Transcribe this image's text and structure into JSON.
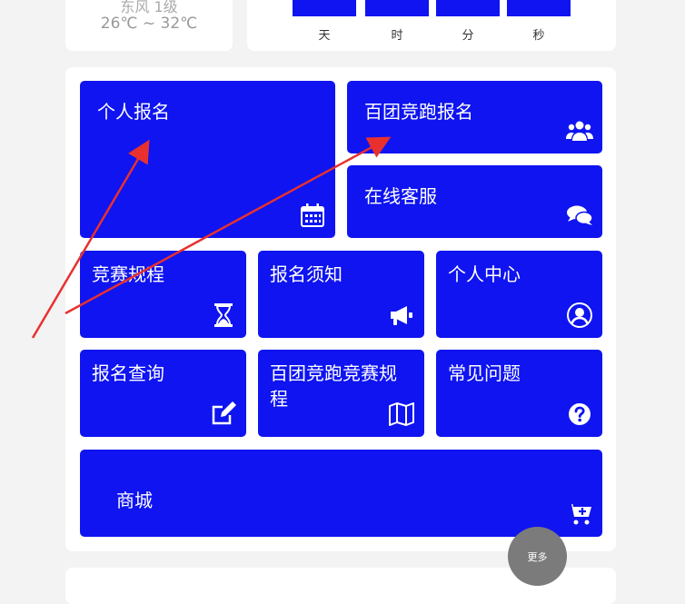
{
  "weather": {
    "wind": "东风 1级",
    "temp": "26℃ ~ 32℃"
  },
  "countdown": {
    "units": [
      "天",
      "时",
      "分",
      "秒"
    ]
  },
  "menu": {
    "personal_signup": "个人报名",
    "group_signup": "百团竞跑报名",
    "online_service": "在线客服",
    "race_rules": "竞赛规程",
    "signup_notice": "报名须知",
    "personal_center": "个人中心",
    "signup_query": "报名查询",
    "group_race_rules": "百团竞跑竞赛规程",
    "faq": "常见问题",
    "mall": "商城"
  },
  "more_label": "更多",
  "colors": {
    "tile": "#0f14f0",
    "annotation_arrow": "#e8312f",
    "more_button": "#7b7b7b"
  },
  "icons": [
    "calendar-icon",
    "users-group-icon",
    "chat-bubbles-icon",
    "hourglass-icon",
    "megaphone-icon",
    "user-circle-icon",
    "edit-icon",
    "map-icon",
    "question-circle-icon",
    "cart-plus-icon"
  ]
}
